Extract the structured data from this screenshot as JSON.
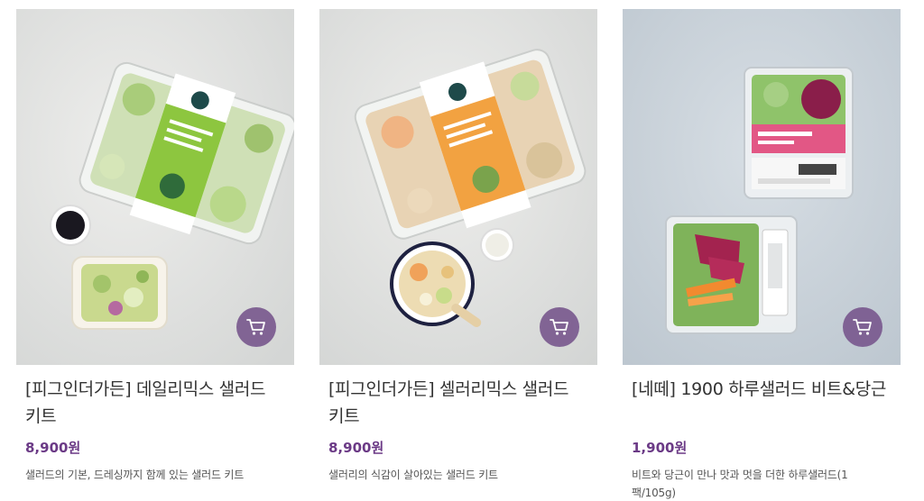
{
  "products": [
    {
      "title": "[피그인더가든] 데일리믹스 샐러드 키트",
      "price": "8,900원",
      "description": "샐러드의 기본, 드레싱까지 함께 있는 샐러드 키트",
      "image_alt": "데일리 믹스 샐러드 KIT"
    },
    {
      "title": "[피그인더가든] 셀러리믹스 샐러드 키트",
      "price": "8,900원",
      "description": "샐러리의 식감이 살아있는 샐러드 키트",
      "image_alt": "셀러리 믹스 샐러드 KIT"
    },
    {
      "title": "[네떼] 1900 하루샐러드 비트&당근",
      "price": "1,900원",
      "description": "비트와 당근이 만나 맛과 멋을 더한 하루샐러드(1팩/105g)",
      "image_alt": "1900 하루샐러드"
    }
  ],
  "cart_icon": "cart-icon",
  "colors": {
    "accent": "#6b3a86",
    "cart_button": "#7a5a8f"
  }
}
